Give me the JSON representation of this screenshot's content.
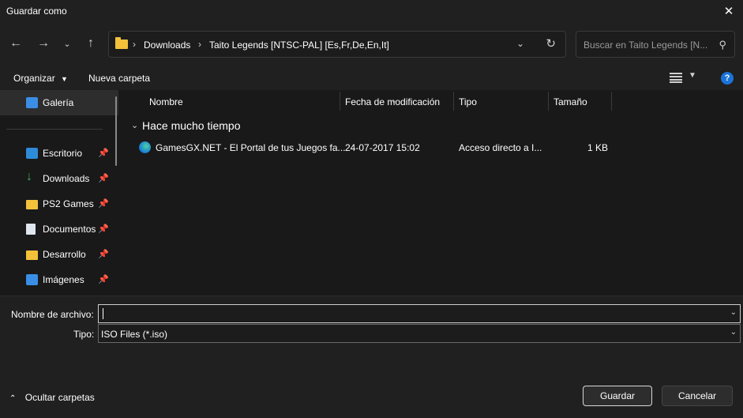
{
  "window": {
    "title": "Guardar como",
    "close_icon": "close-icon"
  },
  "nav": {
    "breadcrumbs": [
      "Downloads",
      "Taito Legends [NTSC-PAL] [Es,Fr,De,En,It]"
    ],
    "search_placeholder": "Buscar en Taito Legends [N..."
  },
  "toolbar": {
    "organize": "Organizar",
    "new_folder": "Nueva carpeta"
  },
  "sidebar": {
    "items": [
      {
        "label": "Galería",
        "icon": "gallery-icon"
      },
      {
        "label": "Escritorio",
        "icon": "desktop-icon"
      },
      {
        "label": "Downloads",
        "icon": "download-icon"
      },
      {
        "label": "PS2 Games",
        "icon": "folder-icon"
      },
      {
        "label": "Documentos",
        "icon": "documents-icon"
      },
      {
        "label": "Desarrollo",
        "icon": "folder-icon"
      },
      {
        "label": "Imágenes",
        "icon": "pictures-icon"
      }
    ]
  },
  "columns": {
    "name": "Nombre",
    "date": "Fecha de modificación",
    "type": "Tipo",
    "size": "Tamaño"
  },
  "group": {
    "title": "Hace mucho tiempo"
  },
  "files": [
    {
      "name": "GamesGX.NET - El Portal de tus Juegos fa...",
      "date": "24-07-2017 15:02",
      "type": "Acceso directo a I...",
      "size": "1 KB"
    }
  ],
  "form": {
    "filename_label": "Nombre de archivo:",
    "filename_value": "",
    "type_label": "Tipo:",
    "type_value": "ISO Files (*.iso)"
  },
  "footer": {
    "hide_folders": "Ocultar carpetas",
    "save": "Guardar",
    "cancel": "Cancelar"
  }
}
